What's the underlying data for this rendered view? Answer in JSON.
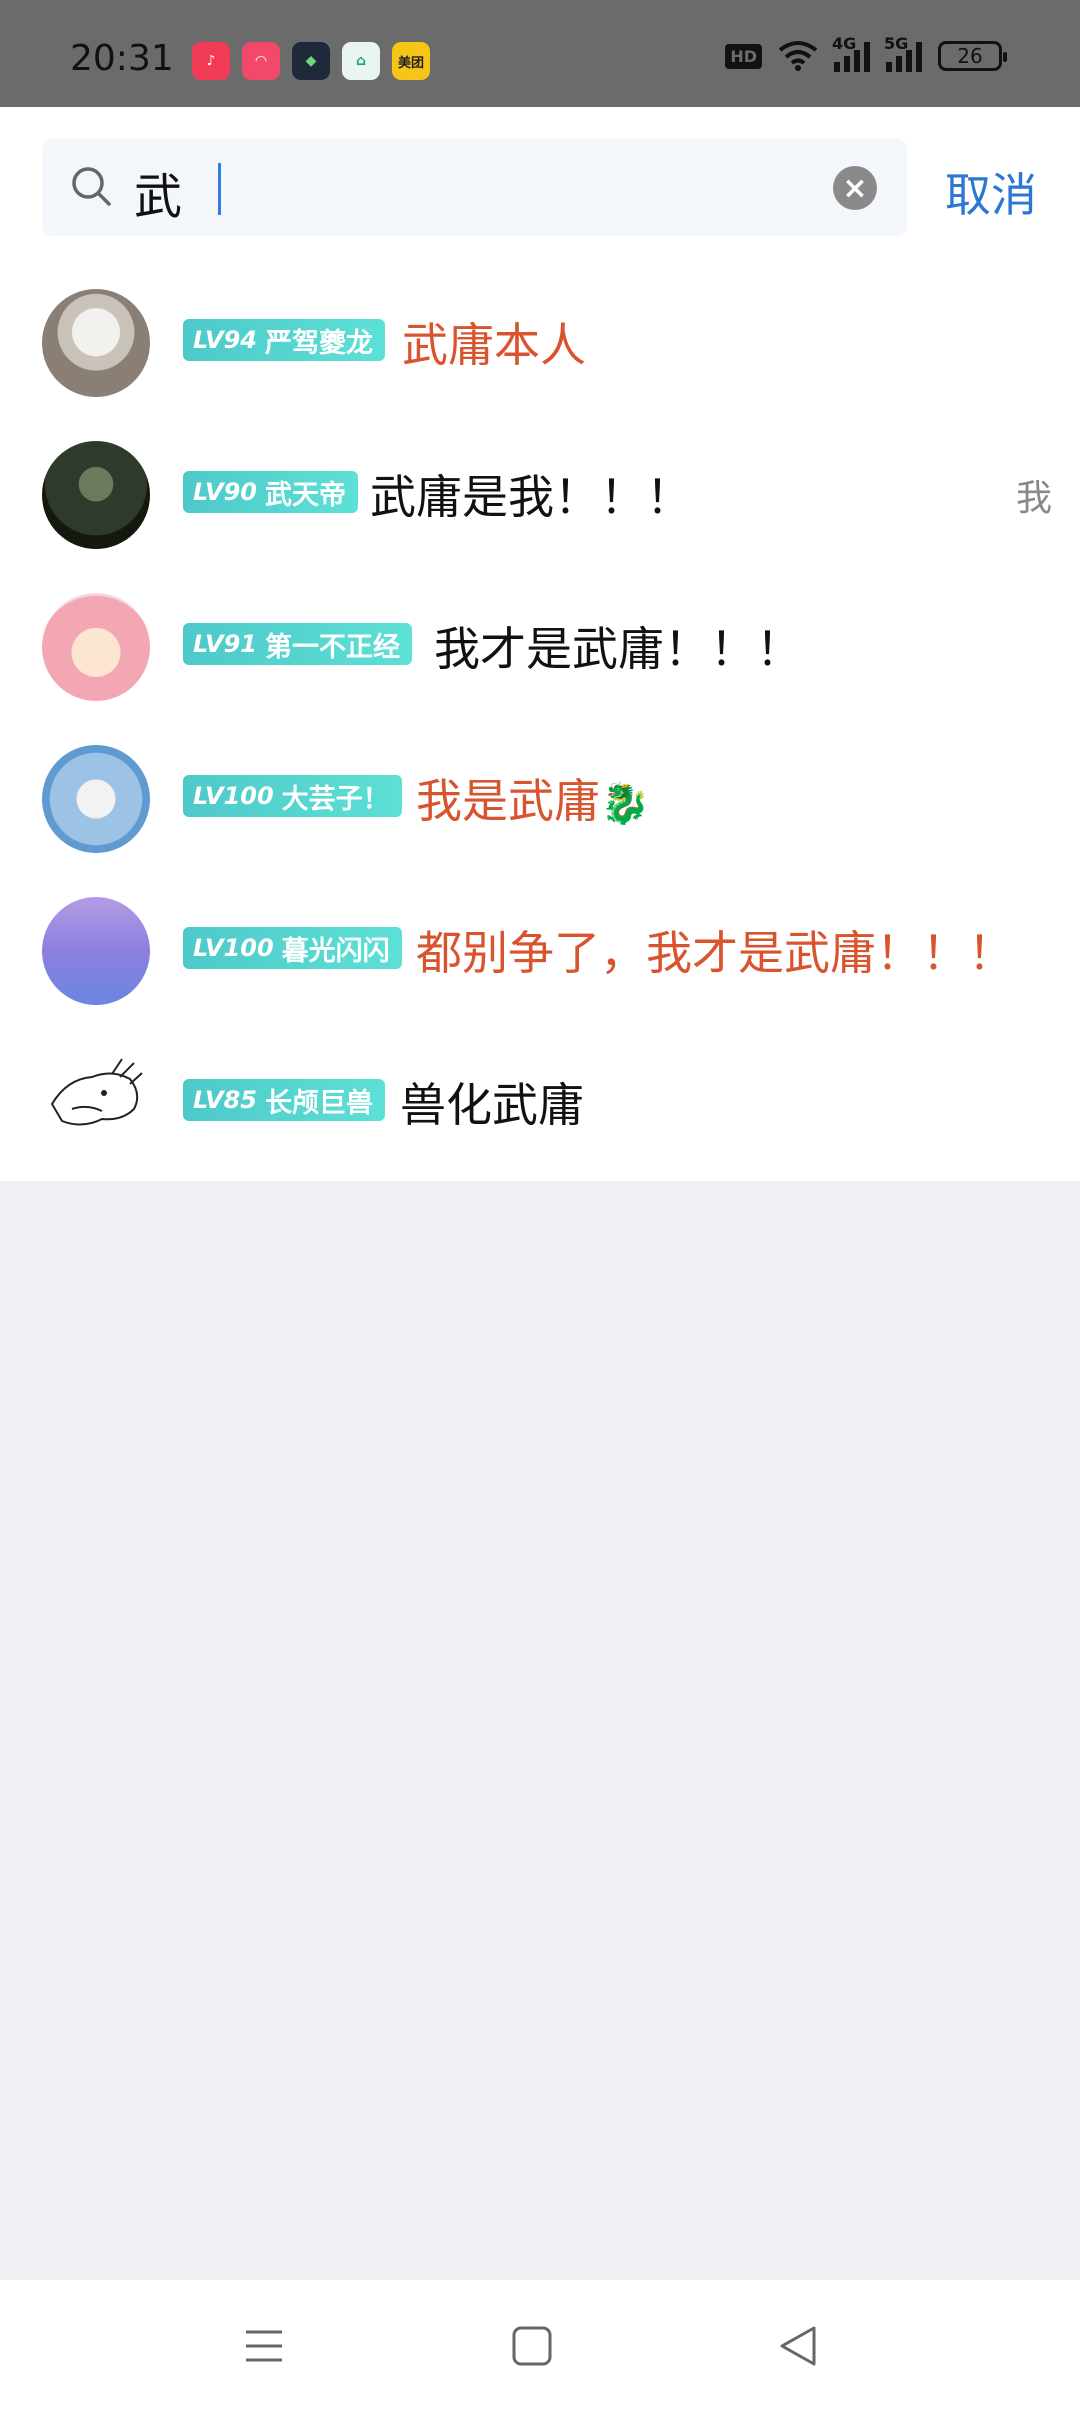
{
  "status_bar": {
    "time": "20:31",
    "app_icons": [
      {
        "name": "music-app-icon",
        "color": "#f03a56",
        "glyph": "♪"
      },
      {
        "name": "bilibili-like-app-icon",
        "color": "#f0496a",
        "glyph": "◠"
      },
      {
        "name": "shield-app-icon",
        "color": "#1e2a3a",
        "glyph": "◆"
      },
      {
        "name": "home-app-icon",
        "color": "#e9f5ef",
        "glyph": "⌂"
      },
      {
        "name": "meituan-app-icon",
        "color": "#f5c518",
        "glyph": "美团"
      }
    ],
    "hd_label": "HD",
    "net1": "4G",
    "net2": "5G",
    "battery": "26"
  },
  "search": {
    "query": "武",
    "cancel_label": "取消",
    "clear_icon": "close-icon"
  },
  "results": [
    {
      "level": "LV94",
      "title": "严驾夔龙",
      "name": "武庸本人",
      "color": "#d9532f",
      "side": ""
    },
    {
      "level": "LV90",
      "title": "武天帝",
      "name": "武庸是我！！！",
      "color": "#111111",
      "side": "我"
    },
    {
      "level": "LV91",
      "title": "第一不正经",
      "name": "我才是武庸！！！",
      "color": "#111111",
      "side": ""
    },
    {
      "level": "LV100",
      "title": "大芸子！",
      "name": "我是武庸",
      "color": "#d9532f",
      "side": ""
    },
    {
      "level": "LV100",
      "title": "暮光闪闪",
      "name": "都别争了，我才是武庸！！！",
      "color": "#d9532f",
      "side": ""
    },
    {
      "level": "LV85",
      "title": "长颅巨兽",
      "name": "兽化武庸",
      "color": "#111111",
      "side": ""
    }
  ],
  "nav": {
    "menu_icon": "menu-icon",
    "home_icon": "home-square-icon",
    "back_icon": "back-triangle-icon"
  }
}
